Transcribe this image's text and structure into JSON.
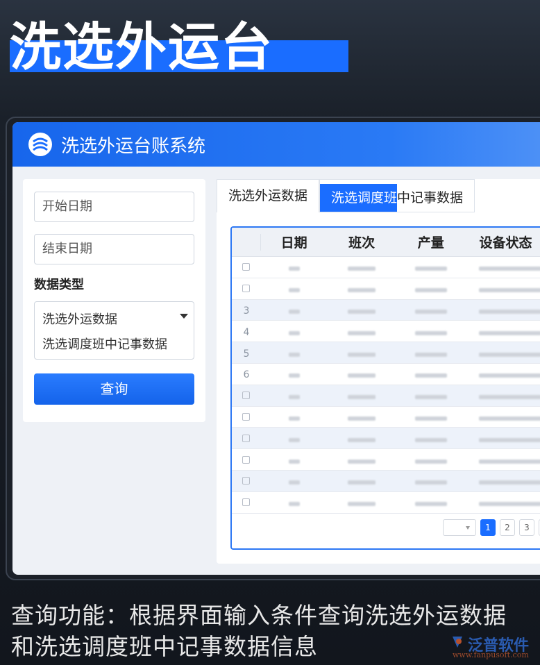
{
  "hero_title": "洗选外运台",
  "app": {
    "title": "洗选外运台账系统"
  },
  "query_panel": {
    "start_date_placeholder": "开始日期",
    "end_date_placeholder": "结束日期",
    "data_type_label": "数据类型",
    "options": [
      "洗选外运数据",
      "洗选调度班中记事数据"
    ],
    "query_button": "查询"
  },
  "tabs": [
    {
      "label": "洗选外运数据"
    },
    {
      "label_a": "洗选调度班",
      "label_b": "中记事数据"
    }
  ],
  "table": {
    "headers": [
      "日期",
      "班次",
      "产量",
      "设备状态"
    ],
    "row_markers": [
      "checkbox",
      "checkbox",
      "3",
      "4",
      "5",
      "6",
      "checkbox",
      "checkbox",
      "checkbox",
      "checkbox",
      "checkbox",
      "checkbox"
    ]
  },
  "pager": {
    "pages": [
      "1",
      "2",
      "3"
    ],
    "current": "1"
  },
  "caption": {
    "line1": "查询功能：根据界面输入条件查询洗选外运数据",
    "line2": "和洗选调度班中记事数据信息"
  },
  "watermark": {
    "brand": "泛普软件",
    "url": "www.fanpusoft.com"
  },
  "colors": {
    "accent": "#1a6dff"
  }
}
